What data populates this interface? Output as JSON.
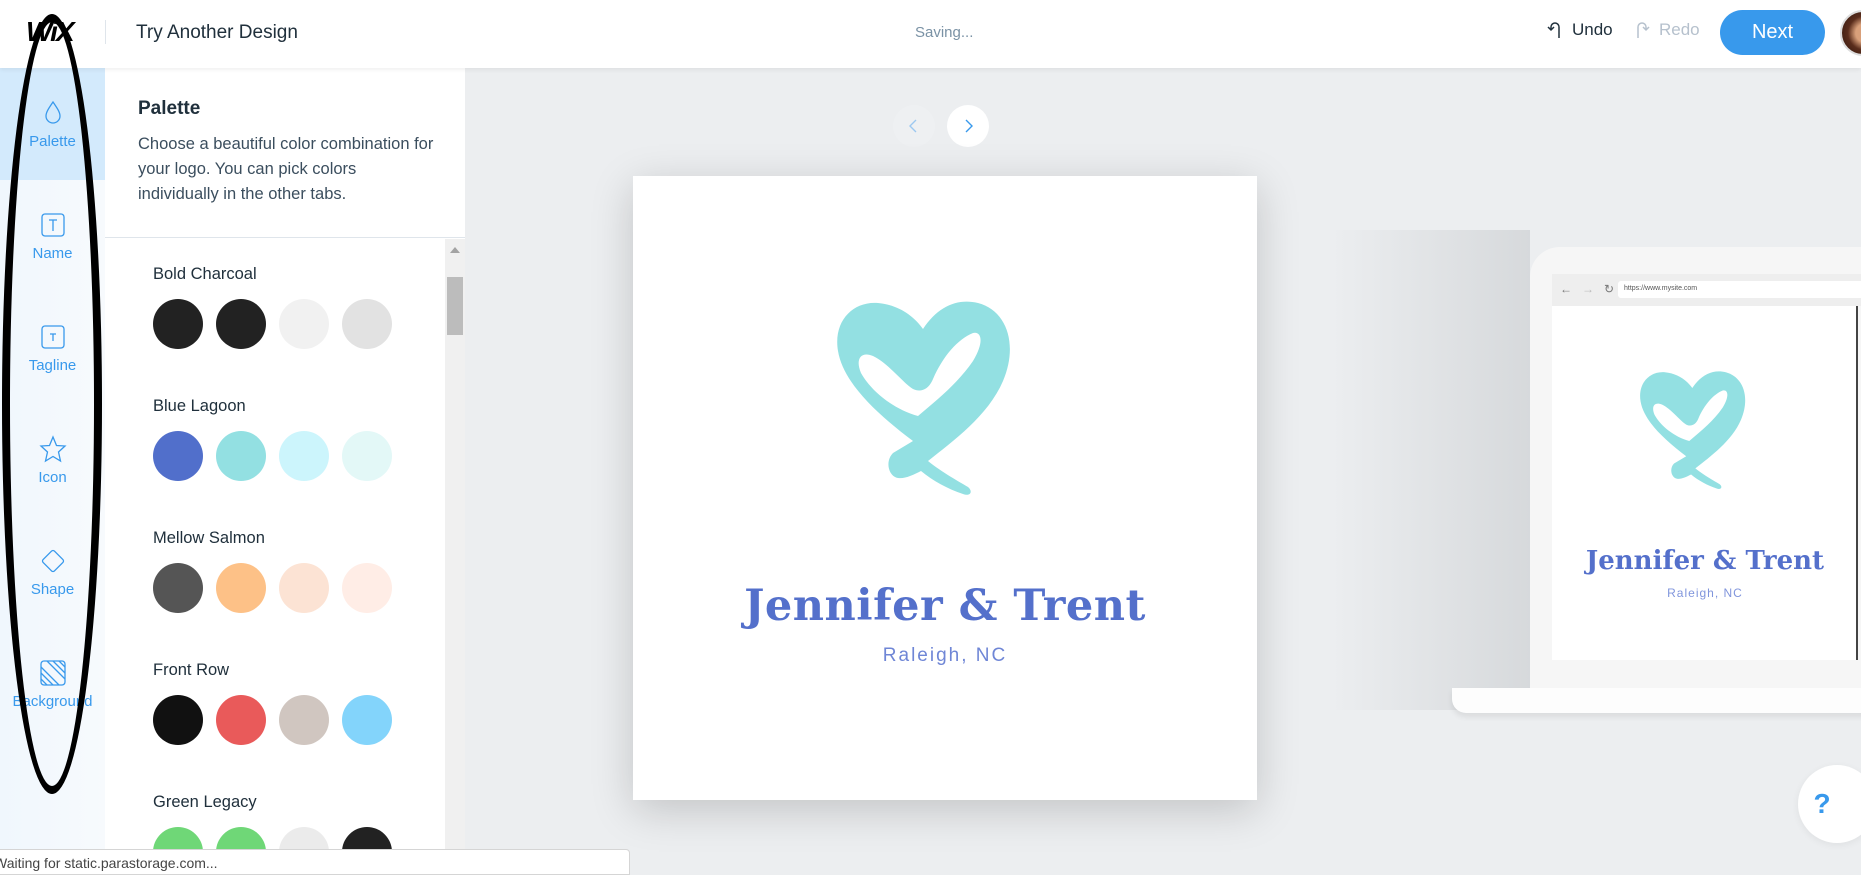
{
  "header": {
    "logo": "WiX",
    "title": "Try Another Design",
    "status": "Saving...",
    "undo_label": "Undo",
    "redo_label": "Redo",
    "next_label": "Next",
    "icons": {
      "undo": "undo-arrow-icon",
      "redo": "redo-arrow-icon",
      "avatar": "user-avatar"
    }
  },
  "sidebar": {
    "items": [
      {
        "label": "Palette",
        "icon": "droplet-icon",
        "active": true
      },
      {
        "label": "Name",
        "icon": "text-box-icon",
        "active": false
      },
      {
        "label": "Tagline",
        "icon": "text-box-small-icon",
        "active": false
      },
      {
        "label": "Icon",
        "icon": "star-icon",
        "active": false
      },
      {
        "label": "Shape",
        "icon": "diamond-icon",
        "active": false
      },
      {
        "label": "Background",
        "icon": "hatched-square-icon",
        "active": false
      }
    ]
  },
  "panel": {
    "title": "Palette",
    "description": "Choose a beautiful color combination for your logo. You can pick colors individually in the other tabs.",
    "palettes": [
      {
        "name": "Bold Charcoal",
        "colors": [
          "#222222",
          "#222222",
          "#f1f1f1",
          "#e2e2e2"
        ]
      },
      {
        "name": "Blue Lagoon",
        "colors": [
          "#516fcb",
          "#93e0e2",
          "#ccf5fc",
          "#e3f8f7"
        ]
      },
      {
        "name": "Mellow Salmon",
        "colors": [
          "#555555",
          "#fdc187",
          "#fce3d4",
          "#ffede6"
        ]
      },
      {
        "name": "Front Row",
        "colors": [
          "#111111",
          "#e95a5a",
          "#d0c6c0",
          "#83d4fb"
        ]
      },
      {
        "name": "Green Legacy",
        "colors": [
          "#6fd777",
          "#6fd777",
          "#ebebeb",
          "#222222"
        ]
      }
    ]
  },
  "canvas": {
    "prev_icon": "chevron-left-icon",
    "next_icon": "chevron-right-icon",
    "logo": {
      "name": "Jennifer & Trent",
      "tagline": "Raleigh, NC",
      "icon": "heart-icon",
      "icon_color": "#93e0e2",
      "text_color": "#5470cb"
    },
    "mockup": {
      "url": "https://www.mysite.com",
      "name": "Jennifer & Trent",
      "tagline": "Raleigh, NC"
    }
  },
  "help": {
    "label": "?"
  },
  "statusbar": {
    "text": "Waiting for static.parastorage.com..."
  },
  "colors": {
    "accent": "#3899ec",
    "sidebar_active": "#d3eafc"
  }
}
